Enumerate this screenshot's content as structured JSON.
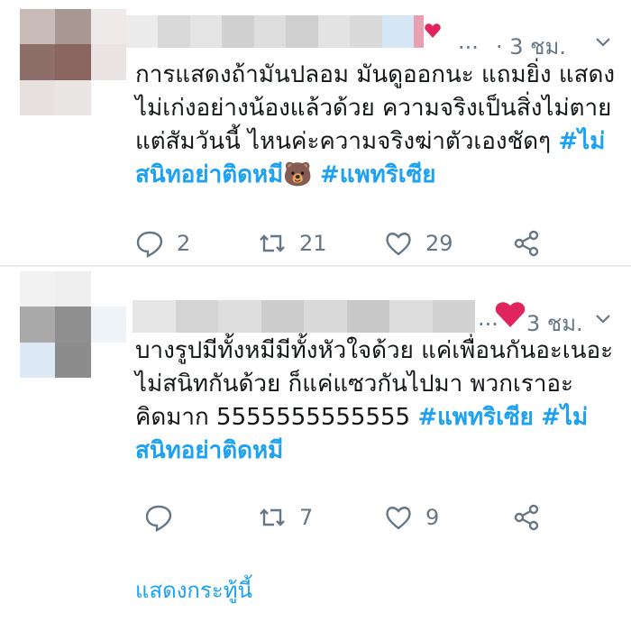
{
  "tweets": [
    {
      "time": "· 3 ชม.",
      "more": "...",
      "text_plain": "การแสดงถ้ามันปลอม มันดูออกนะ แถมยิ่ง แสดงไม่เก่งอย่างน้องแล้วด้วย ความจริงเป็นสิ่งไม่ตาย แต่สัมวันนี้ ไหนค่ะความจริงฆ่าตัวเองชัดๆ ",
      "hashtag1": "#ไม่สนิทอย่าติดหมี",
      "emoji": "🐻",
      "hashtag2": "#แพทริเซีย",
      "replies": "2",
      "retweets": "21",
      "likes": "29"
    },
    {
      "time": "3 ชม.",
      "more": "...",
      "text_plain": "บางรูปมีทั้งหมีมีทั้งหัวใจด้วย แค่เพื่อนกันอะเนอะ ไม่สนิทกันด้วย ก็แค่แซวกันไปมา พวกเราอะคิดมาก 5555555555555 ",
      "hashtag1": "#แพทริเซีย",
      "hashtag2": "#ไม่สนิทอย่าติดหมี",
      "replies": "",
      "retweets": "7",
      "likes": "9"
    }
  ],
  "show_thread": "แสดงกระทู้นี้",
  "colors": {
    "accent": "#1da1f2",
    "meta": "#657786",
    "heart": "#e0245e"
  }
}
